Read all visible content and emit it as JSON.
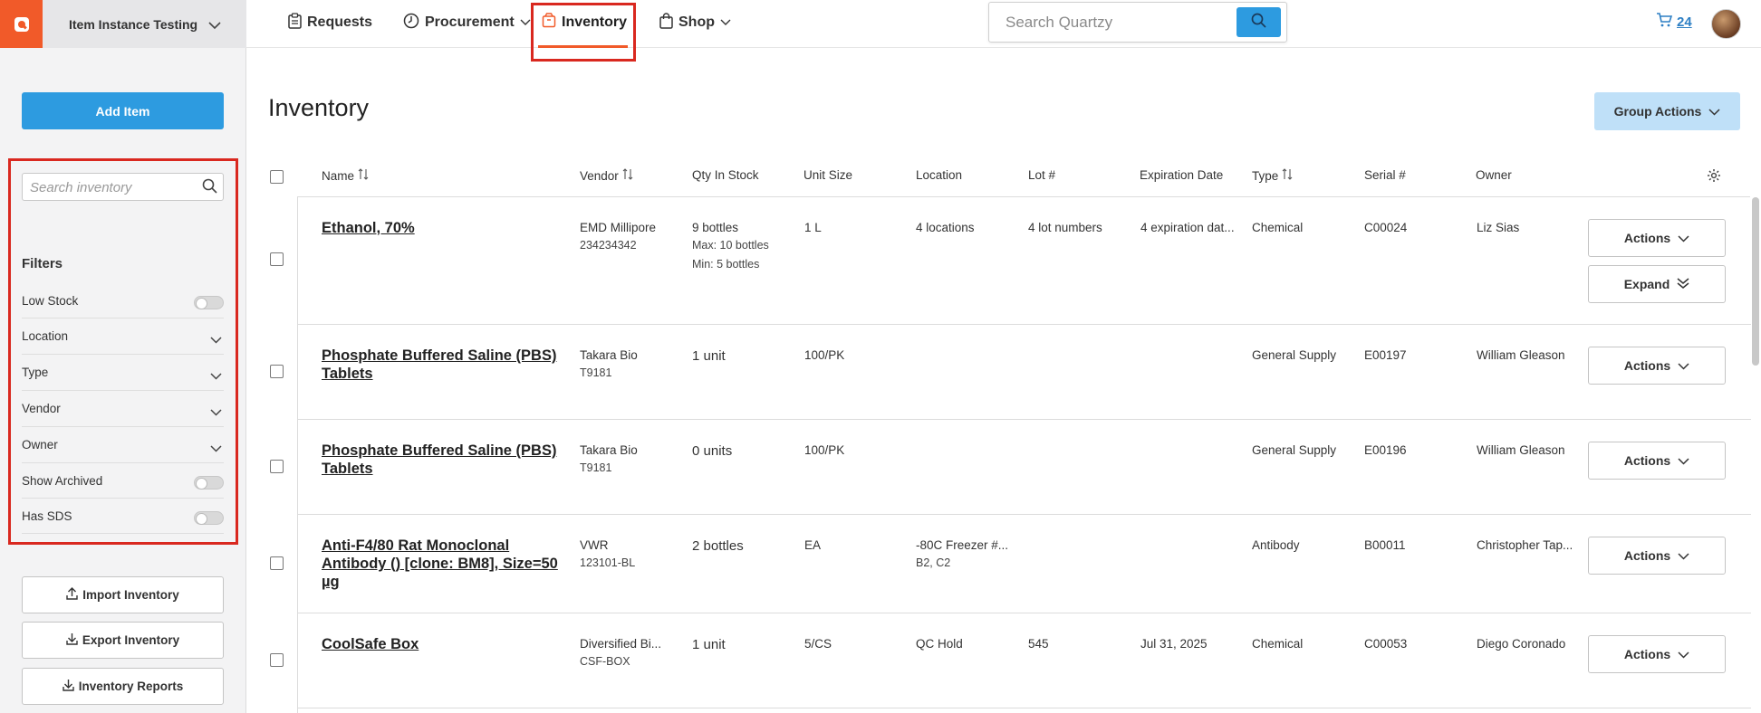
{
  "sidebar": {
    "lab_name": "Item Instance Testing",
    "add_item_label": "Add Item",
    "search_placeholder": "Search inventory",
    "filters_title": "Filters",
    "filters": [
      {
        "label": "Low Stock",
        "kind": "toggle",
        "on": false
      },
      {
        "label": "Location",
        "kind": "dropdown"
      },
      {
        "label": "Type",
        "kind": "dropdown"
      },
      {
        "label": "Vendor",
        "kind": "dropdown"
      },
      {
        "label": "Owner",
        "kind": "dropdown"
      },
      {
        "label": "Show Archived",
        "kind": "toggle",
        "on": false
      },
      {
        "label": "Has SDS",
        "kind": "toggle",
        "on": false
      }
    ],
    "import_label": "Import Inventory",
    "export_label": "Export Inventory",
    "reports_label": "Inventory Reports"
  },
  "topnav": {
    "items": [
      {
        "label": "Requests",
        "icon": "clipboard-icon"
      },
      {
        "label": "Procurement",
        "icon": "clock-icon",
        "dropdown": true
      },
      {
        "label": "Inventory",
        "icon": "box-icon",
        "active": true
      },
      {
        "label": "Shop",
        "icon": "bag-icon",
        "dropdown": true
      }
    ],
    "search_placeholder": "Search Quartzy",
    "cart_count": "24"
  },
  "main": {
    "title": "Inventory",
    "group_actions_label": "Group Actions",
    "columns": [
      "Name",
      "Vendor",
      "Qty In Stock",
      "Unit Size",
      "Location",
      "Lot #",
      "Expiration Date",
      "Type",
      "Serial #",
      "Owner"
    ],
    "rows": [
      {
        "name": "Ethanol, 70%",
        "vendor": "EMD Millipore",
        "catalog": "234234342",
        "qty": "9 bottles",
        "qty_max": "Max: 10 bottles",
        "qty_min": "Min: 5 bottles",
        "unit_size": "1 L",
        "location": "4 locations",
        "location2": "",
        "lot": "4 lot numbers",
        "expiration": "4 expiration dat...",
        "type": "Chemical",
        "serial": "C00024",
        "owner": "Liz Sias",
        "actions_label": "Actions",
        "expand_label": "Expand"
      },
      {
        "name": "Phosphate Buffered Saline (PBS) Tablets",
        "vendor": "Takara Bio",
        "catalog": "T9181",
        "qty": "1 unit",
        "unit_size": "100/PK",
        "location": "",
        "lot": "",
        "expiration": "",
        "type": "General Supply",
        "serial": "E00197",
        "owner": "William Gleason",
        "actions_label": "Actions"
      },
      {
        "name": "Phosphate Buffered Saline (PBS) Tablets",
        "vendor": "Takara Bio",
        "catalog": "T9181",
        "qty": "0 units",
        "unit_size": "100/PK",
        "location": "",
        "lot": "",
        "expiration": "",
        "type": "General Supply",
        "serial": "E00196",
        "owner": "William Gleason",
        "actions_label": "Actions"
      },
      {
        "name": "Anti-F4/80 Rat Monoclonal Antibody () [clone: BM8], Size=50 µg",
        "vendor": "VWR",
        "catalog": "123101-BL",
        "qty": "2 bottles",
        "unit_size": "EA",
        "location": "-80C Freezer #...",
        "location2": "B2, C2",
        "lot": "",
        "expiration": "",
        "type": "Antibody",
        "serial": "B00011",
        "owner": "Christopher Tap...",
        "actions_label": "Actions"
      },
      {
        "name": "CoolSafe Box",
        "vendor": "Diversified Bi...",
        "catalog": "CSF-BOX",
        "qty": "1 unit",
        "unit_size": "5/CS",
        "location": "QC Hold",
        "lot": "545",
        "expiration": "Jul 31, 2025",
        "type": "Chemical",
        "serial": "C00053",
        "owner": "Diego Coronado",
        "actions_label": "Actions"
      }
    ]
  },
  "colors": {
    "brand": "#f15a29",
    "primary": "#2d9be0",
    "highlight": "#d9281f",
    "group_actions_bg": "#bfe0f8"
  }
}
